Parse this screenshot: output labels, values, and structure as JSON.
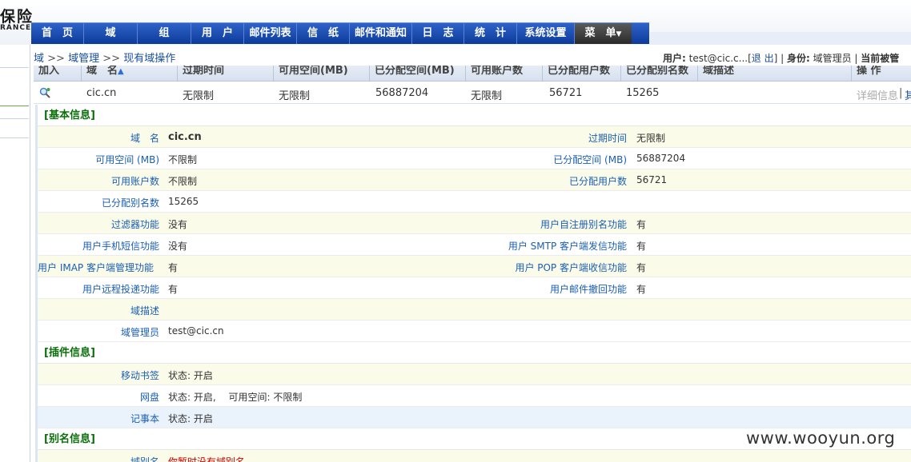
{
  "logo": {
    "main": "保险",
    "sub": "RANCE"
  },
  "nav": {
    "items": [
      "首　页",
      "域",
      "组",
      "用　户",
      "邮件列表",
      "信　纸",
      "邮件和通知",
      "日　志",
      "统　计",
      "系统设置"
    ],
    "menu_label": "菜　单"
  },
  "breadcrumb": {
    "root": "域",
    "sep1": ">>",
    "mid": "域管理",
    "sep2": ">>",
    "current": "现有域操作"
  },
  "userinfo": {
    "user_label": "用户:",
    "user_value": "test@cic.c...",
    "logout": "退 出",
    "role_label": "身份:",
    "role_value": "域管理员",
    "current_label": "当前被管"
  },
  "list": {
    "headers": [
      "加入",
      "域　名",
      "过期时间",
      "可用空间(MB)",
      "已分配空间(MB)",
      "可用账户数",
      "已分配用户数",
      "已分配别名数",
      "域描述",
      "操 作"
    ],
    "row": {
      "domain": "cic.cn",
      "expire": "无限制",
      "space": "无限制",
      "allocated_space": "56887204",
      "accounts": "无限制",
      "allocated_users": "56721",
      "allocated_aliases": "15265",
      "desc": "",
      "op_detail": "详细信息",
      "op_sep": "|",
      "op_more": "其"
    }
  },
  "basic": {
    "title": "[基本信息]",
    "domain_label": "域　名",
    "domain_value": "cic.cn",
    "expire_label": "过期时间",
    "expire_value": "无限制",
    "space_label": "可用空间 (MB)",
    "space_value": "不限制",
    "alloc_space_label": "已分配空间 (MB)",
    "alloc_space_value": "56887204",
    "accounts_label": "可用账户数",
    "accounts_value": "不限制",
    "alloc_users_label": "已分配用户数",
    "alloc_users_value": "56721",
    "alloc_alias_label": "已分配别名数",
    "alloc_alias_value": "15265",
    "filter_label": "过滤器功能",
    "filter_value": "没有",
    "self_alias_label": "用户自注册别名功能",
    "self_alias_value": "有",
    "sms_label": "用户手机短信功能",
    "sms_value": "没有",
    "smtp_label": "用户 SMTP 客户端发信功能",
    "smtp_value": "有",
    "imap_label": "用户 IMAP 客户端管理功能",
    "imap_value": "有",
    "pop_label": "用户 POP 客户端收信功能",
    "pop_value": "有",
    "remote_label": "用户远程投递功能",
    "remote_value": "有",
    "recall_label": "用户邮件撤回功能",
    "recall_value": "有",
    "desc_label": "域描述",
    "desc_value": "",
    "admin_label": "域管理员",
    "admin_value": "test@cic.cn"
  },
  "plugins": {
    "title": "[插件信息]",
    "bookmark_label": "移动书签",
    "bookmark_value": "状态: 开启",
    "disk_label": "网盘",
    "disk_value": "状态: 开启,　 可用空间: 不限制",
    "notes_label": "记事本",
    "notes_value": "状态: 开启"
  },
  "alias": {
    "title": "[别名信息]",
    "alias_label": "域别名",
    "alias_value": "你暂时没有域别名"
  },
  "watermark": "www.wooyun.org"
}
